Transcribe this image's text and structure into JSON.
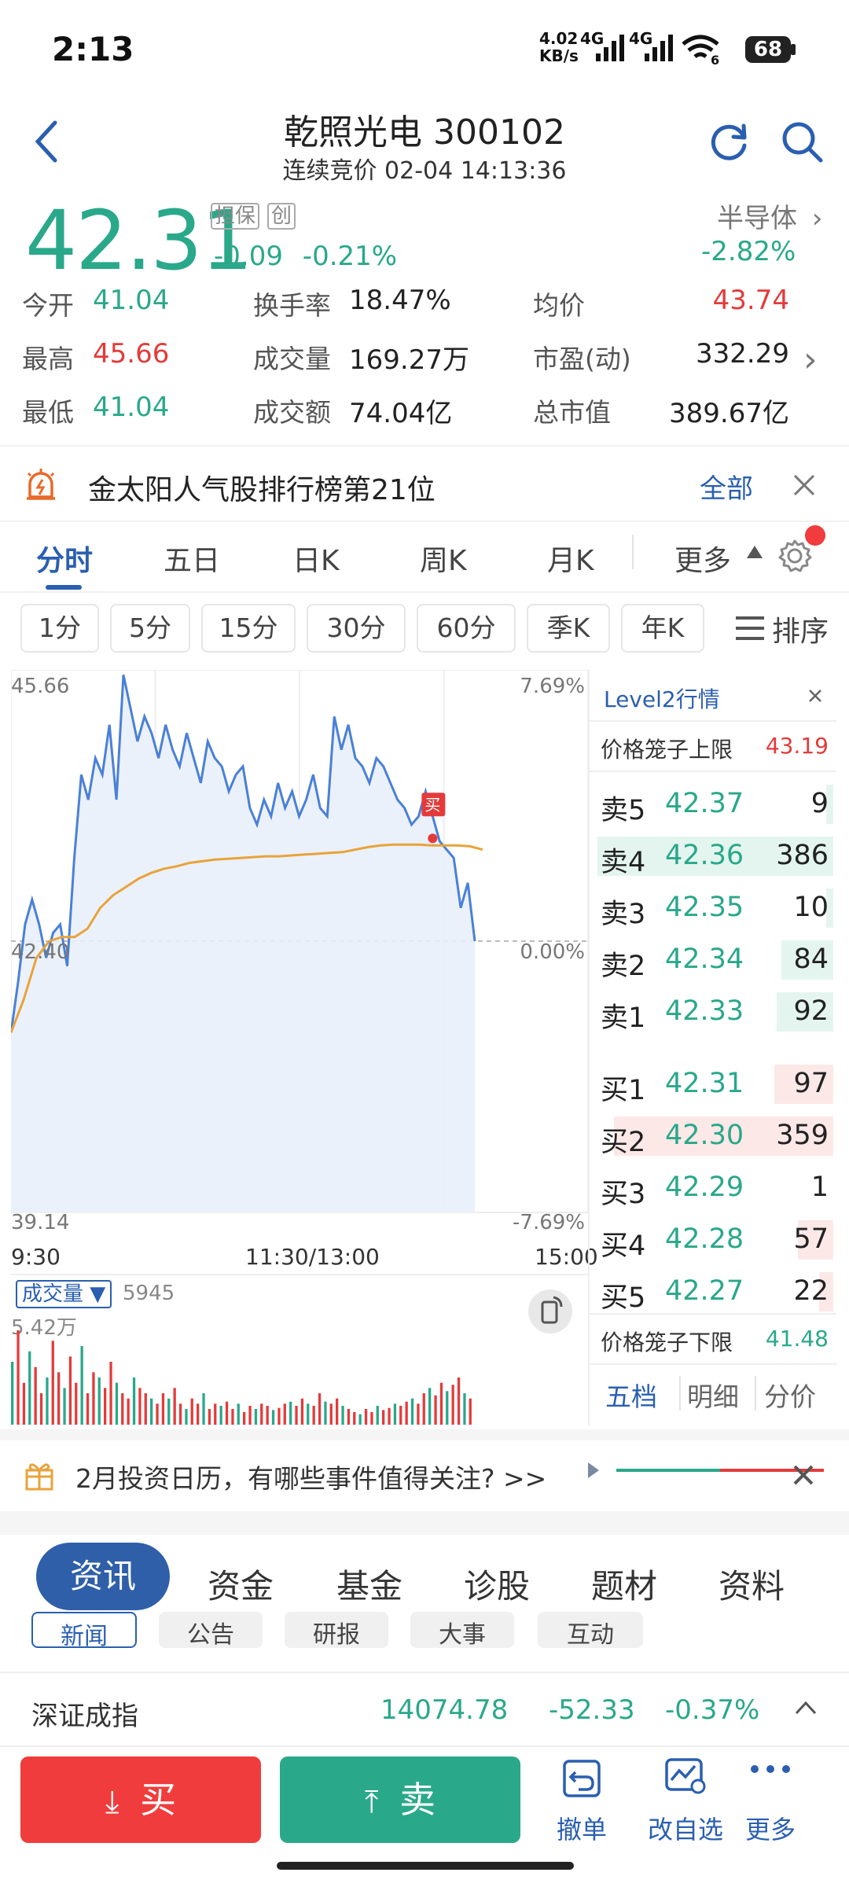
{
  "status": {
    "time": "2:13",
    "net_speed_top": "4.02",
    "net_speed_bottom": "KB/s",
    "sig1": "4G",
    "sig2": "4G",
    "wifi_sub": "6",
    "battery": "68"
  },
  "header": {
    "title": "乾照光电 300102",
    "subtitle": "连续竞价 02-04 14:13:36"
  },
  "quote": {
    "price": "42.31",
    "tag1": "担保",
    "tag2": "创",
    "change": "-0.09",
    "change_pct": "-0.21%",
    "sector": "半导体",
    "sector_pct": "-2.82%",
    "stats": [
      {
        "label": "今开",
        "value": "41.04",
        "color": "green"
      },
      {
        "label": "换手率",
        "value": "18.47%",
        "color": "black"
      },
      {
        "label": "均价",
        "value": "43.74",
        "color": "red"
      },
      {
        "label": "最高",
        "value": "45.66",
        "color": "red"
      },
      {
        "label": "成交量",
        "value": "169.27万",
        "color": "black"
      },
      {
        "label": "市盈(动)",
        "value": "332.29",
        "color": "black"
      },
      {
        "label": "最低",
        "value": "41.04",
        "color": "green"
      },
      {
        "label": "成交额",
        "value": "74.04亿",
        "color": "black"
      },
      {
        "label": "总市值",
        "value": "389.67亿",
        "color": "black"
      }
    ]
  },
  "rank_banner": {
    "text": "金太阳人气股排行榜第21位",
    "all": "全部"
  },
  "chart_tabs": [
    "分时",
    "五日",
    "日K",
    "周K",
    "月K",
    "更多"
  ],
  "period_chips": [
    "1分",
    "5分",
    "15分",
    "30分",
    "60分",
    "季K",
    "年K"
  ],
  "sort_label": "排序",
  "chart_data": {
    "type": "line",
    "y_max_label": "45.66",
    "y_mid_label": "42.40",
    "y_min_label": "39.14",
    "pct_max_label": "7.69%",
    "pct_mid_label": "0.00%",
    "pct_min_label": "-7.69%",
    "time_labels": [
      "9:30",
      "11:30/13:00",
      "15:00"
    ],
    "ylim": [
      39.14,
      45.66
    ],
    "buy_marker": "买",
    "series": [
      {
        "values": [
          41.3,
          41.9,
          42.6,
          42.9,
          42.6,
          42.2,
          42.5,
          42.6,
          42.1,
          43.4,
          44.4,
          44.1,
          44.6,
          44.4,
          45.0,
          44.1,
          45.6,
          45.2,
          44.8,
          45.1,
          44.9,
          44.6,
          45.0,
          44.7,
          44.5,
          44.9,
          44.6,
          44.3,
          44.8,
          44.6,
          44.5,
          44.2,
          44.4,
          44.5,
          44.0,
          43.8,
          44.1,
          43.9,
          44.3,
          44.0,
          44.2,
          43.9,
          44.1,
          44.4,
          44.0,
          43.9,
          45.1,
          44.7,
          45.0,
          44.6,
          44.5,
          44.3,
          44.6,
          44.5,
          44.3,
          44.1,
          44.0,
          43.8,
          43.9,
          44.2,
          43.9,
          43.6,
          43.5,
          43.4,
          42.8,
          43.1,
          42.4
        ]
      },
      {
        "values": [
          41.3,
          41.7,
          42.2,
          42.4,
          42.45,
          42.45,
          42.55,
          42.8,
          42.95,
          43.05,
          43.15,
          43.22,
          43.27,
          43.3,
          43.34,
          43.36,
          43.38,
          43.39,
          43.4,
          43.41,
          43.42,
          43.42,
          43.43,
          43.44,
          43.45,
          43.46,
          43.47,
          43.5,
          43.53,
          43.55,
          43.56,
          43.56,
          43.56,
          43.55,
          43.55,
          43.55,
          43.54,
          43.5
        ]
      }
    ]
  },
  "volume": {
    "label": "成交量",
    "current": "5945",
    "max_label": "5.42万",
    "bars": [
      60,
      90,
      40,
      70,
      55,
      30,
      45,
      80,
      50,
      35,
      65,
      40,
      75,
      30,
      50,
      45,
      35,
      60,
      40,
      30,
      25,
      45,
      35,
      30,
      25,
      20,
      30,
      25,
      35,
      20,
      15,
      25,
      20,
      30,
      15,
      20,
      18,
      22,
      15,
      20,
      12,
      18,
      15,
      20,
      18,
      14,
      16,
      20,
      22,
      18,
      25,
      20,
      18,
      30,
      22,
      20,
      25,
      18,
      15,
      12,
      10,
      15,
      12,
      18,
      14,
      16,
      20,
      18,
      22,
      25,
      20,
      30,
      35,
      28,
      40,
      32,
      38,
      45,
      30,
      25
    ]
  },
  "level2": {
    "title": "Level2行情",
    "upper_limit_label": "价格笼子上限",
    "upper_limit": "43.19",
    "lower_limit_label": "价格笼子下限",
    "lower_limit": "41.48",
    "asks": [
      {
        "label": "卖5",
        "price": "42.37",
        "vol": "9",
        "bar": 0.03
      },
      {
        "label": "卖4",
        "price": "42.36",
        "vol": "386",
        "bar": 1.0
      },
      {
        "label": "卖3",
        "price": "42.35",
        "vol": "10",
        "bar": 0.03
      },
      {
        "label": "卖2",
        "price": "42.34",
        "vol": "84",
        "bar": 0.22
      },
      {
        "label": "卖1",
        "price": "42.33",
        "vol": "92",
        "bar": 0.24
      }
    ],
    "bids": [
      {
        "label": "买1",
        "price": "42.31",
        "vol": "97",
        "bar": 0.25
      },
      {
        "label": "买2",
        "price": "42.30",
        "vol": "359",
        "bar": 0.93
      },
      {
        "label": "买3",
        "price": "42.29",
        "vol": "1",
        "bar": 0.0
      },
      {
        "label": "买4",
        "price": "42.28",
        "vol": "57",
        "bar": 0.15
      },
      {
        "label": "买5",
        "price": "42.27",
        "vol": "22",
        "bar": 0.06
      }
    ],
    "tabs": [
      "五档",
      "明细",
      "分价"
    ]
  },
  "announcement": {
    "text": "2月投资日历，有哪些事件值得关注? >>"
  },
  "bottom_tabs": [
    "资讯",
    "资金",
    "基金",
    "诊股",
    "题材",
    "资料"
  ],
  "sub_chips": [
    "新闻",
    "公告",
    "研报",
    "大事",
    "互动"
  ],
  "index_bar": {
    "name": "深证成指",
    "value": "14074.78",
    "change": "-52.33",
    "pct": "-0.37%"
  },
  "actions": {
    "buy": "买",
    "sell": "卖",
    "cancel": "撤单",
    "watchlist": "改自选",
    "more": "更多"
  },
  "colors": {
    "up": "#e33b3b",
    "down": "#2aa88a",
    "accent": "#2a5fb0",
    "price_line": "#4a80d8",
    "avg_line": "#e8a33a"
  }
}
